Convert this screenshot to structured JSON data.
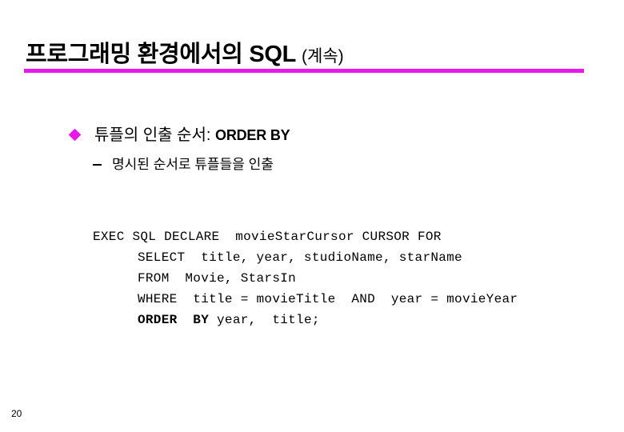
{
  "slide": {
    "title": {
      "main": "프로그래밍 환경에서의 SQL",
      "suffix": "(계속)"
    },
    "accent_color": "#ea17ea",
    "text_color": "#000000",
    "background_color": "#ffffff",
    "page_number": "20"
  },
  "bullets": [
    {
      "level": 1,
      "marker": "diamond-bullet-icon",
      "text": "튜플의 인출 순서: ",
      "emphasis": "ORDER BY"
    },
    {
      "level": 2,
      "marker": "dash-bullet-icon",
      "text": "명시된 순서로 튜플들을 인출"
    }
  ],
  "code_block": {
    "lines": [
      {
        "indent": false,
        "text": "EXEC SQL DECLARE  movieStarCursor CURSOR FOR",
        "bold_prefix": ""
      },
      {
        "indent": true,
        "text": "SELECT  title, year, studioName, starName",
        "bold_prefix": ""
      },
      {
        "indent": true,
        "text": "FROM  Movie, StarsIn",
        "bold_prefix": ""
      },
      {
        "indent": true,
        "text": "WHERE  title = movieTitle  AND  year = movieYear",
        "bold_prefix": ""
      },
      {
        "indent": true,
        "text": " year,  title;",
        "bold_prefix": "ORDER  BY"
      }
    ]
  }
}
